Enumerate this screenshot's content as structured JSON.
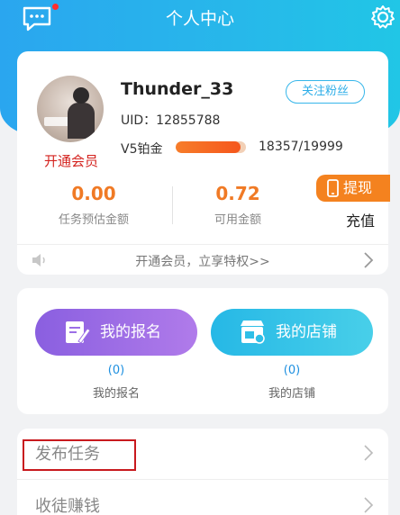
{
  "header": {
    "title": "个人中心",
    "message_icon": "message-icon",
    "settings_icon": "gear-icon",
    "accent": "#2aa6ef"
  },
  "profile": {
    "username": "Thunder_33",
    "follow_label": "关注粉丝",
    "uid": "UID：12855788",
    "vip_link": "开通会员",
    "level_label": "V5铂金",
    "level_progress": 0.918,
    "level_progress_text": "18357/19999"
  },
  "stats": [
    {
      "value": "0.00",
      "label": "任务预估金额"
    },
    {
      "value": "0.72",
      "label": "可用金额"
    }
  ],
  "withdraw_label": "提现",
  "recharge_label": "充值",
  "notice": {
    "text": "开通会员，立享特权>>"
  },
  "actions": [
    {
      "label": "我的报名",
      "count": "(0)",
      "sub": "我的报名"
    },
    {
      "label": "我的店铺",
      "count": "(0)",
      "sub": "我的店铺"
    }
  ],
  "list": [
    {
      "label": "发布任务"
    },
    {
      "label": "收徒赚钱"
    }
  ]
}
